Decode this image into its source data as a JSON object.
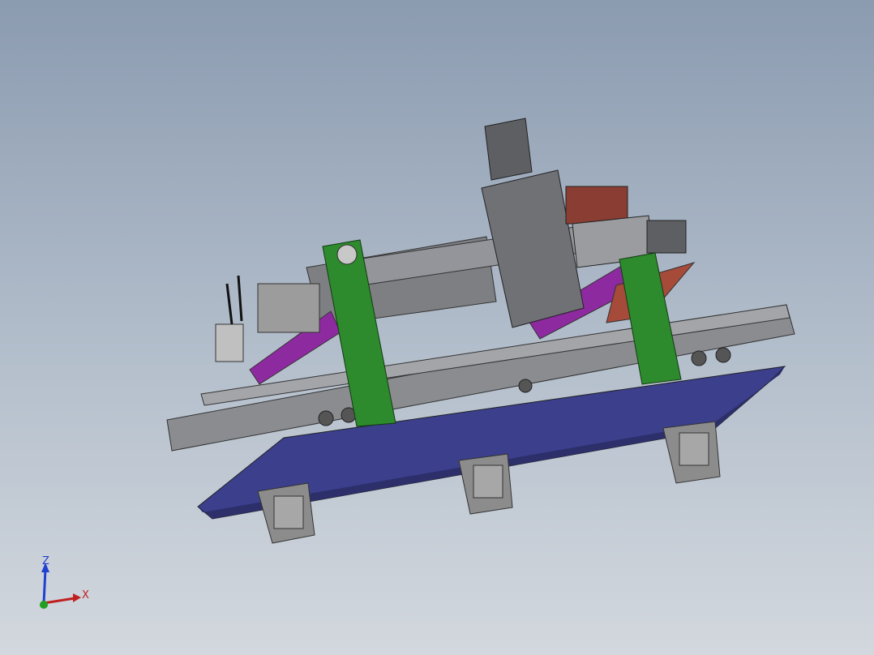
{
  "viewport": {
    "background_top": "#8b9bb0",
    "background_bottom": "#d3d8de"
  },
  "model": {
    "description_icon": "cnc-gantry-assembly",
    "colors": {
      "base_plate": "#3b3f8c",
      "uprights": "#2d8a2d",
      "rails": "#8a8c90",
      "diagonal_brace": "#8e2aa0",
      "spindle_block": "#7a7c80",
      "motor": "#6a6a6e",
      "accent_red": "#a64a3a"
    }
  },
  "triad": {
    "z_label": "Z",
    "x_label": "X",
    "z_color": "#2040d0",
    "x_color": "#c02020",
    "y_color": "#20a020"
  }
}
